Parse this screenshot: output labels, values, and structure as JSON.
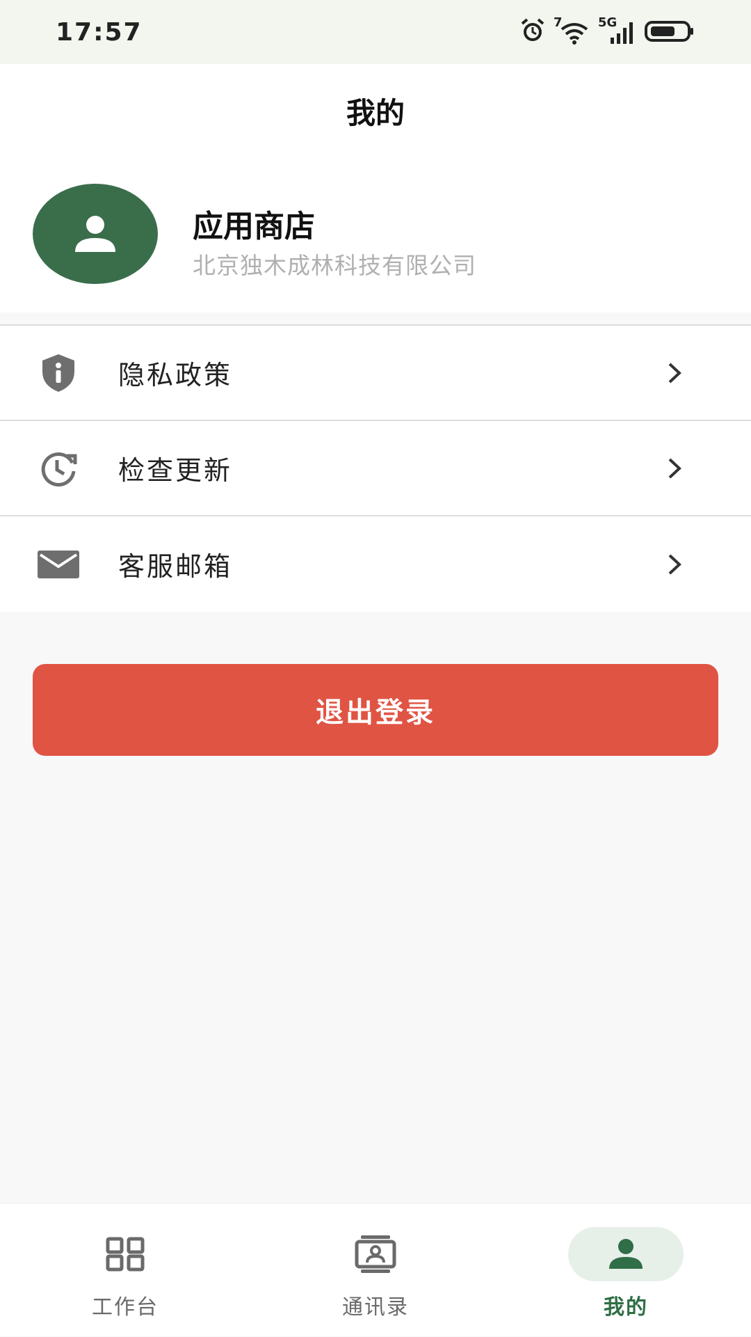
{
  "status_bar": {
    "time": "17:57",
    "icons": [
      "alarm-icon",
      "wifi-icon",
      "cellular-5g-icon",
      "battery-icon"
    ],
    "wifi_badge": "7",
    "network_label": "5G"
  },
  "header": {
    "title": "我的"
  },
  "profile": {
    "avatar_icon": "person-icon",
    "name": "应用商店",
    "company": "北京独木成林科技有限公司"
  },
  "menu": {
    "items": [
      {
        "label": "隐私政策",
        "icon": "shield-info-icon"
      },
      {
        "label": "检查更新",
        "icon": "update-clock-icon"
      },
      {
        "label": "客服邮箱",
        "icon": "mail-icon"
      }
    ]
  },
  "logout": {
    "label": "退出登录"
  },
  "bottom_nav": {
    "items": [
      {
        "label": "工作台",
        "icon": "grid-icon",
        "active": false
      },
      {
        "label": "通讯录",
        "icon": "contacts-icon",
        "active": false
      },
      {
        "label": "我的",
        "icon": "person-icon",
        "active": true
      }
    ]
  },
  "colors": {
    "accent": "#3a6e4b",
    "logout": "#e05444",
    "status_bar_bg": "#f2f6ee",
    "page_bg": "#f8f8f8"
  }
}
